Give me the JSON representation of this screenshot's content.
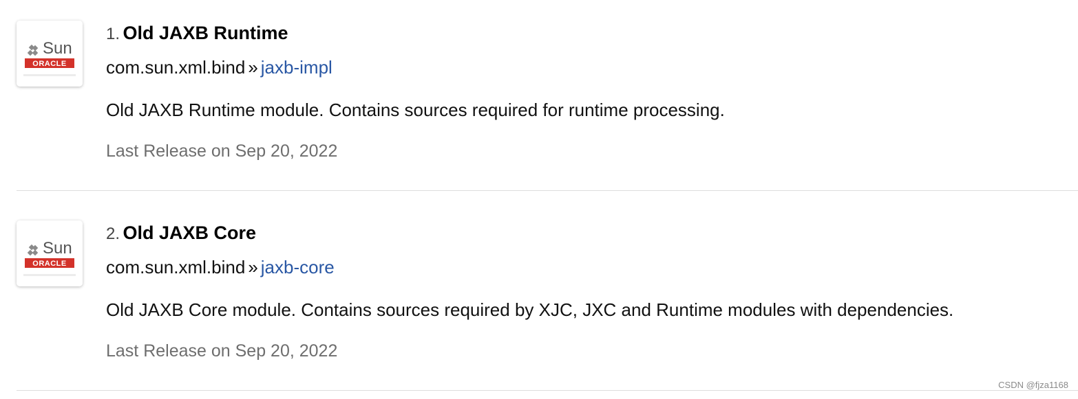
{
  "results": [
    {
      "rank": "1.",
      "title": "Old JAXB Runtime",
      "group": "com.sun.xml.bind",
      "separator": "»",
      "artifact": "jaxb-impl",
      "description": "Old JAXB Runtime module. Contains sources required for runtime processing.",
      "release": "Last Release on Sep 20, 2022",
      "logo": {
        "brand": "Sun",
        "sub": "ORACLE",
        "icon": "sun-oracle-logo"
      }
    },
    {
      "rank": "2.",
      "title": "Old JAXB Core",
      "group": "com.sun.xml.bind",
      "separator": "»",
      "artifact": "jaxb-core",
      "description": "Old JAXB Core module. Contains sources required by XJC, JXC and Runtime modules with dependencies.",
      "release": "Last Release on Sep 20, 2022",
      "logo": {
        "brand": "Sun",
        "sub": "ORACLE",
        "icon": "sun-oracle-logo"
      }
    }
  ],
  "watermark": "CSDN @fjza1168",
  "colors": {
    "link": "#2957a4",
    "release_text": "#6e6e6e",
    "oracle_red": "#d3322a",
    "divider": "#dddddd"
  }
}
